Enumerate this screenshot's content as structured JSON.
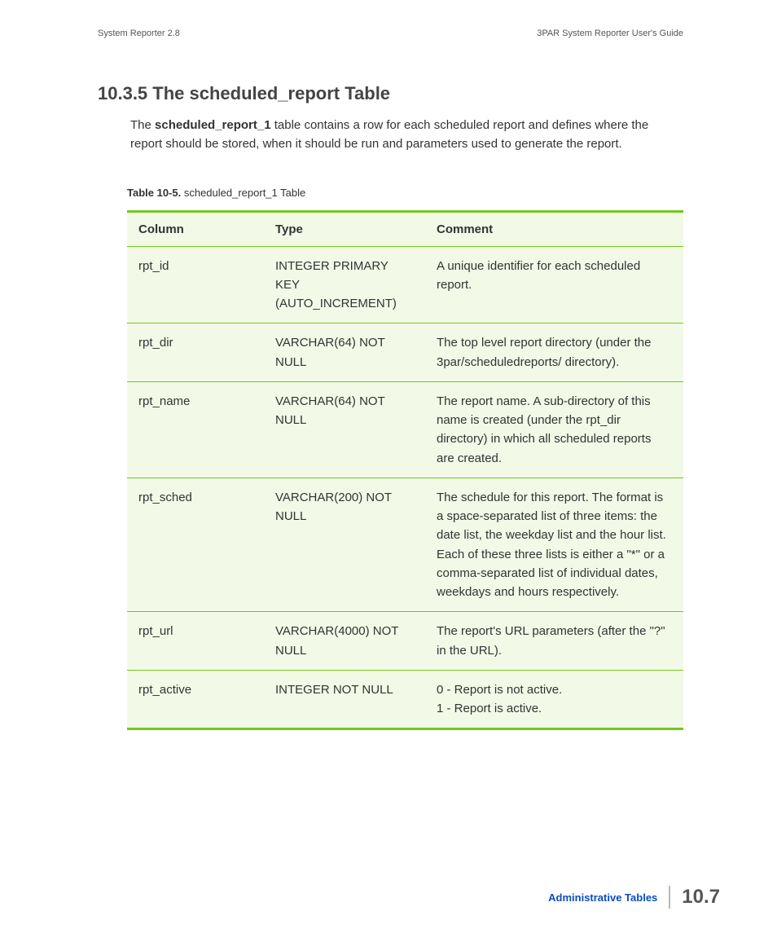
{
  "header": {
    "left": "System Reporter 2.8",
    "right": "3PAR System Reporter User's Guide"
  },
  "section": {
    "title": "10.3.5 The scheduled_report Table",
    "intro_pre": "The ",
    "intro_bold": "scheduled_report_1",
    "intro_post": " table contains a row for each scheduled report and defines where the report should be stored, when it should be run and parameters used to generate the report."
  },
  "table": {
    "caption_bold": "Table 10-5.",
    "caption_rest": "  scheduled_report_1 Table",
    "headers": {
      "c0": "Column",
      "c1": "Type",
      "c2": "Comment"
    },
    "rows": [
      {
        "c0": "rpt_id",
        "c1": "INTEGER PRIMARY KEY (AUTO_INCREMENT)",
        "c2": "A unique identifier for each scheduled report."
      },
      {
        "c0": "rpt_dir",
        "c1": "VARCHAR(64) NOT NULL",
        "c2": "The top level report directory (under the 3par/scheduledreports/ directory)."
      },
      {
        "c0": "rpt_name",
        "c1": "VARCHAR(64) NOT NULL",
        "c2": "The report name. A sub-directory of this name is created (under the rpt_dir directory) in which all scheduled reports are created."
      },
      {
        "c0": "rpt_sched",
        "c1": "VARCHAR(200) NOT NULL",
        "c2": "The schedule for this report. The format is a space-separated list of three items: the date list, the weekday list and the hour list. Each of these three lists is either a \"*\" or a comma-separated list of individual dates, weekdays and hours respectively."
      },
      {
        "c0": "rpt_url",
        "c1": "VARCHAR(4000) NOT NULL",
        "c2": "The report's URL parameters (after the \"?\" in the URL)."
      },
      {
        "c0": "rpt_active",
        "c1": "INTEGER NOT NULL",
        "c2": "0 - Report is not active.\n1 - Report is active."
      }
    ]
  },
  "footer": {
    "section": "Administrative Tables",
    "page": "10.7"
  }
}
